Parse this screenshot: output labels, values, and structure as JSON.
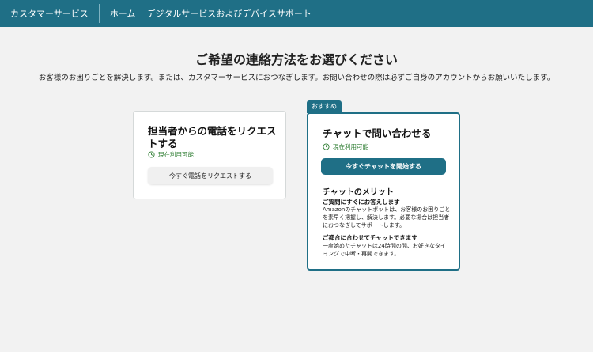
{
  "header": {
    "brand": "カスタマーサービス",
    "nav": [
      "ホーム",
      "デジタルサービスおよびデバイスサポート"
    ]
  },
  "main": {
    "title": "ご希望の連絡方法をお選びください",
    "subtitle": "お客様のお困りごとを解決します。または、カスタマーサービスにおつなぎします。お問い合わせの際は必ずご自身のアカウントからお願いいたします。"
  },
  "phone_card": {
    "title": "担当者からの電話をリクエストする",
    "availability": "現在利用可能",
    "button": "今すぐ電話をリクエストする"
  },
  "chat_card": {
    "badge": "おすすめ",
    "title": "チャットで問い合わせる",
    "availability": "現在利用可能",
    "button": "今すぐチャットを開始する",
    "merit_title": "チャットのメリット",
    "merits": [
      {
        "heading": "ご質問にすぐにお答えします",
        "body": "Amazonのチャットボットは、お客様のお困りごとを素早く把握し、解決します。必要な場合は担当者におつなぎしてサポートします。"
      },
      {
        "heading": "ご都合に合わせてチャットできます",
        "body": "一度始めたチャットは24時間の間、お好きなタイミングで中断・再開できます。"
      }
    ]
  },
  "colors": {
    "header_bg": "#1f6f86",
    "accent": "#1f6f86",
    "available": "#2e7d32"
  }
}
